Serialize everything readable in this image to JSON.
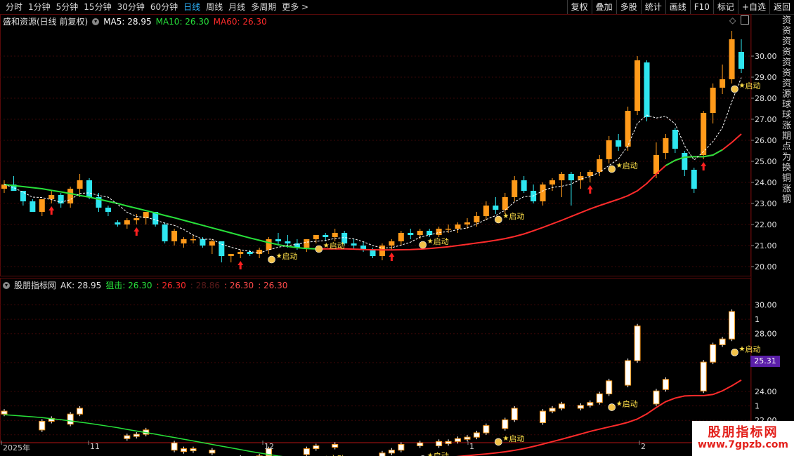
{
  "toolbar": {
    "tabs": [
      "分时",
      "1分钟",
      "5分钟",
      "15分钟",
      "30分钟",
      "60分钟",
      "日线",
      "周线",
      "月线",
      "多周期",
      "更多 >"
    ],
    "active_tab": "日线",
    "tools": [
      "复权",
      "叠加",
      "多股",
      "统计",
      "画线",
      "F10",
      "标记",
      "+自选",
      "返回"
    ]
  },
  "main_header": {
    "title": "盛和资源(日线 前复权)",
    "ma5": "MA5: 28.95",
    "ma10": "MA10: 26.30",
    "ma60": "MA60: 26.30"
  },
  "sub_header": {
    "title": "股朋指标网",
    "ak": "AK: 28.95",
    "zj": "狙击: 26.30",
    "c3": ": 26.30",
    "c4": ": 28.86",
    "c5": ": 26.30",
    "c6": ": 26.30"
  },
  "price_axis": [
    "30.00",
    "29.00",
    "28.00",
    "27.00",
    "26.00",
    "25.00",
    "24.00",
    "23.00",
    "22.00",
    "21.00",
    "20.00"
  ],
  "sub_axis": [
    "30.00",
    "1",
    "28.00",
    "1",
    "24.00",
    "1",
    "22.00",
    "1"
  ],
  "current_badge": "25.31",
  "signal_label": "启动",
  "dates": [
    "2025年",
    "11",
    "12",
    "1",
    "2"
  ],
  "right_side_text": "资资资资资资资源球球涨期点为换铜涨钢",
  "watermark": {
    "title": "股朋指标网",
    "url": "www.7gpzb.com"
  },
  "colors": {
    "up": "#ff9a1a",
    "down": "#2ee6f0",
    "ma10": "#27e03a",
    "ma60": "#ff2b2b",
    "grid": "#5a0a0a",
    "active_tab": "#2fb6ff"
  },
  "chart_data": {
    "type": "candlestick",
    "ohlc": [
      [
        23.7,
        24.1,
        23.5,
        23.9
      ],
      [
        23.9,
        24.3,
        23.6,
        23.6
      ],
      [
        23.6,
        23.6,
        22.9,
        23.1
      ],
      [
        23.1,
        23.2,
        22.6,
        22.6
      ],
      [
        22.6,
        23.2,
        22.4,
        23.2
      ],
      [
        23.2,
        23.6,
        23.0,
        23.4
      ],
      [
        23.4,
        23.5,
        22.8,
        23.0
      ],
      [
        23.0,
        23.8,
        22.8,
        23.7
      ],
      [
        23.7,
        24.4,
        23.3,
        24.1
      ],
      [
        24.1,
        24.2,
        23.2,
        23.3
      ],
      [
        23.3,
        23.5,
        22.6,
        22.8
      ],
      [
        22.8,
        22.9,
        22.4,
        22.6
      ],
      [
        22.1,
        22.2,
        21.9,
        22.0
      ],
      [
        22.0,
        22.3,
        21.8,
        22.2
      ],
      [
        22.2,
        22.5,
        22.0,
        22.3
      ],
      [
        22.3,
        22.6,
        22.0,
        22.6
      ],
      [
        22.6,
        22.6,
        21.9,
        22.0
      ],
      [
        22.0,
        22.1,
        21.1,
        21.2
      ],
      [
        21.2,
        21.8,
        21.0,
        21.7
      ],
      [
        21.1,
        21.4,
        20.9,
        21.3
      ],
      [
        21.3,
        21.5,
        21.1,
        21.3
      ],
      [
        21.3,
        21.4,
        20.9,
        21.0
      ],
      [
        21.0,
        21.3,
        20.6,
        21.2
      ],
      [
        21.2,
        21.2,
        20.2,
        20.5
      ],
      [
        20.5,
        20.6,
        20.2,
        20.6
      ],
      [
        20.6,
        20.8,
        20.4,
        20.7
      ],
      [
        20.7,
        20.8,
        20.5,
        20.6
      ],
      [
        20.6,
        20.9,
        20.4,
        20.8
      ],
      [
        20.8,
        21.4,
        20.6,
        21.3
      ],
      [
        21.3,
        21.6,
        21.0,
        21.2
      ],
      [
        21.2,
        21.5,
        20.9,
        21.1
      ],
      [
        21.1,
        21.3,
        20.8,
        20.9
      ],
      [
        20.9,
        21.3,
        20.7,
        21.3
      ],
      [
        21.3,
        21.5,
        21.1,
        21.5
      ],
      [
        21.5,
        21.6,
        21.2,
        21.4
      ],
      [
        21.4,
        21.8,
        21.2,
        21.6
      ],
      [
        21.6,
        21.7,
        21.0,
        21.1
      ],
      [
        21.1,
        21.3,
        20.8,
        21.0
      ],
      [
        21.0,
        21.2,
        20.7,
        20.8
      ],
      [
        20.8,
        20.9,
        20.4,
        20.5
      ],
      [
        20.5,
        21.1,
        20.3,
        21.0
      ],
      [
        21.0,
        21.3,
        20.8,
        21.2
      ],
      [
        21.2,
        21.7,
        21.0,
        21.6
      ],
      [
        21.6,
        21.8,
        21.3,
        21.5
      ],
      [
        21.5,
        21.8,
        21.3,
        21.7
      ],
      [
        21.7,
        21.8,
        21.4,
        21.5
      ],
      [
        21.5,
        21.9,
        21.4,
        21.8
      ],
      [
        21.8,
        22.0,
        21.6,
        21.8
      ],
      [
        21.8,
        22.1,
        21.6,
        22.0
      ],
      [
        22.0,
        22.3,
        21.8,
        22.1
      ],
      [
        22.1,
        22.6,
        21.9,
        22.4
      ],
      [
        22.4,
        23.1,
        22.2,
        22.9
      ],
      [
        22.9,
        23.3,
        22.5,
        22.7
      ],
      [
        22.7,
        23.5,
        22.5,
        23.3
      ],
      [
        23.3,
        24.3,
        23.1,
        24.1
      ],
      [
        24.1,
        24.3,
        23.5,
        23.6
      ],
      [
        23.6,
        23.9,
        23.0,
        23.1
      ],
      [
        23.1,
        24.0,
        22.9,
        23.9
      ],
      [
        23.9,
        24.2,
        23.6,
        24.1
      ],
      [
        24.1,
        24.5,
        23.3,
        24.4
      ],
      [
        24.4,
        24.5,
        22.9,
        24.1
      ],
      [
        24.1,
        24.5,
        23.7,
        24.3
      ],
      [
        24.3,
        24.6,
        24.0,
        24.5
      ],
      [
        24.5,
        25.3,
        24.3,
        25.1
      ],
      [
        25.1,
        26.2,
        24.9,
        26.0
      ],
      [
        26.0,
        26.3,
        25.5,
        25.7
      ],
      [
        25.7,
        27.6,
        25.5,
        27.4
      ],
      [
        27.4,
        30.0,
        27.2,
        29.8
      ],
      [
        29.7,
        29.8,
        26.9,
        27.1
      ],
      [
        24.4,
        25.9,
        24.2,
        25.3
      ],
      [
        25.4,
        26.3,
        25.1,
        26.1
      ],
      [
        26.5,
        26.6,
        25.4,
        25.6
      ],
      [
        25.4,
        25.5,
        24.3,
        24.6
      ],
      [
        24.6,
        24.7,
        23.5,
        23.7
      ],
      [
        25.3,
        27.4,
        25.1,
        27.3
      ],
      [
        27.3,
        28.7,
        26.8,
        28.5
      ],
      [
        28.5,
        29.6,
        28.2,
        28.9
      ],
      [
        28.9,
        31.2,
        28.7,
        30.8
      ],
      [
        30.2,
        30.8,
        29.2,
        29.4
      ]
    ],
    "ma10": [
      23.9,
      23.85,
      23.8,
      23.75,
      23.7,
      23.62,
      23.55,
      23.47,
      23.38,
      23.3,
      23.2,
      23.1,
      23.0,
      22.88,
      22.77,
      22.66,
      22.55,
      22.43,
      22.32,
      22.2,
      22.08,
      21.96,
      21.84,
      21.72,
      21.6,
      21.48,
      21.36,
      21.25,
      21.14,
      21.04,
      20.96,
      20.9,
      20.86,
      20.84
    ],
    "ma60": [
      20.84,
      20.84,
      20.84,
      20.84,
      20.83,
      20.81,
      20.8,
      20.79,
      20.79,
      20.8,
      20.81,
      20.83,
      20.86,
      20.9,
      20.94,
      21.0,
      21.06,
      21.12,
      21.18,
      21.25,
      21.33,
      21.43,
      21.55,
      21.7,
      21.86,
      22.03,
      22.2,
      22.38,
      22.56,
      22.74,
      22.9,
      23.05,
      23.2,
      23.37,
      23.6,
      23.95,
      24.4,
      24.8,
      25.05,
      25.2,
      25.22,
      25.22,
      25.3,
      25.55,
      25.9,
      26.3
    ],
    "signals": [
      28,
      33,
      44,
      52,
      64,
      77
    ],
    "arrows": [
      5,
      14,
      25,
      41,
      62,
      74
    ],
    "ylim": [
      19.6,
      31.4
    ]
  }
}
